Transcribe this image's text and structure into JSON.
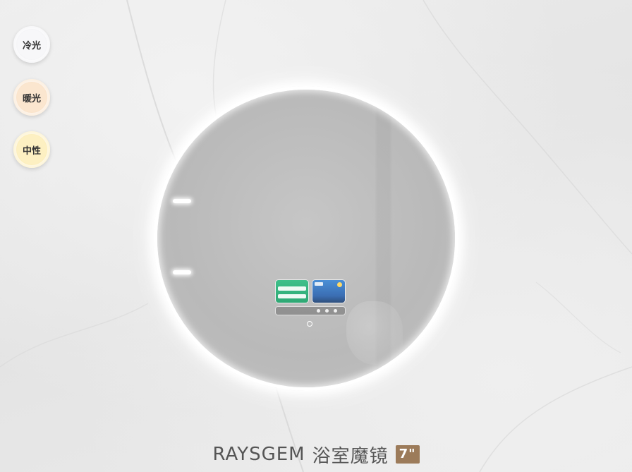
{
  "light_modes": [
    {
      "label": "冷光",
      "color": "#f4f4f6"
    },
    {
      "label": "暖光",
      "color": "#fbe4cc"
    },
    {
      "label": "中性",
      "color": "#fdeebb"
    }
  ],
  "product": {
    "brand": "RAYSGEM",
    "name": "浴室魔镜",
    "size_badge": "7\""
  },
  "colors": {
    "accent_badge": "#9c7b5a",
    "mirror_ring": "#ffffff",
    "time_widget": "#3ec08a",
    "weather_widget": "#4a8fd6"
  }
}
